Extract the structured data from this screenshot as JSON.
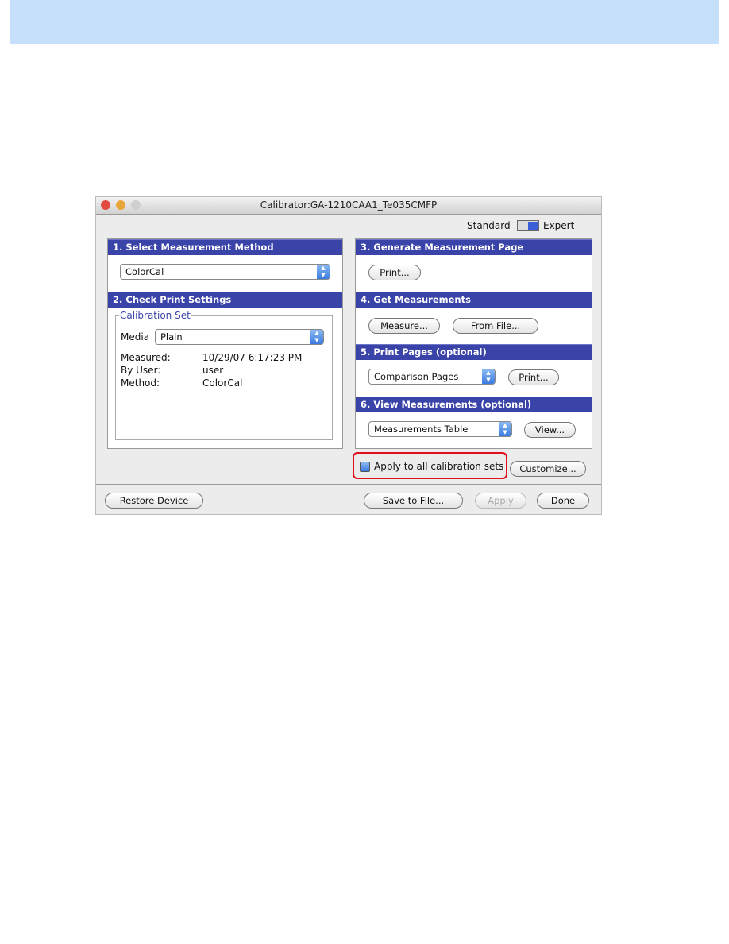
{
  "window": {
    "title": "Calibrator:GA-1210CAA1_Te035CMFP"
  },
  "mode": {
    "standard": "Standard",
    "expert": "Expert",
    "selected": "Expert"
  },
  "panels": {
    "p1": {
      "title": "1. Select Measurement Method",
      "method": "ColorCal"
    },
    "p2": {
      "title": "2. Check Print Settings",
      "group": "Calibration Set",
      "media_label": "Media",
      "media": "Plain",
      "measured_label": "Measured:",
      "measured": "10/29/07 6:17:23 PM",
      "user_label": "By User:",
      "user": "user",
      "method_label": "Method:",
      "method": "ColorCal"
    },
    "p3": {
      "title": "3. Generate Measurement Page",
      "print": "Print..."
    },
    "p4": {
      "title": "4. Get Measurements",
      "measure": "Measure...",
      "from_file": "From File..."
    },
    "p5": {
      "title": "5. Print Pages (optional)",
      "pages": "Comparison Pages",
      "print": "Print..."
    },
    "p6": {
      "title": "6. View Measurements (optional)",
      "view_type": "Measurements Table",
      "view": "View..."
    }
  },
  "apply_all": {
    "label": "Apply to all calibration sets",
    "checked": false,
    "highlight": "#e0101a"
  },
  "buttons": {
    "customize": "Customize...",
    "restore": "Restore Device",
    "save": "Save to File...",
    "apply": "Apply",
    "done": "Done"
  }
}
